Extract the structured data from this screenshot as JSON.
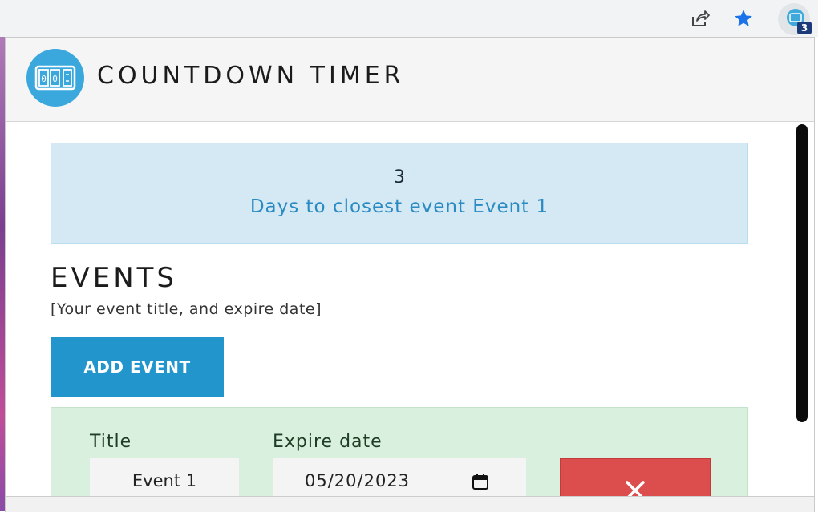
{
  "browser": {
    "share_icon": "share-icon",
    "bookmark_icon": "star-icon",
    "extension_icon": "countdown-extension-icon",
    "extension_badge": "3"
  },
  "app": {
    "title": "COUNTDOWN TIMER",
    "logo_icon": "countdown-timer-logo",
    "logo_digits": "00"
  },
  "notice": {
    "count": "3",
    "text": "Days to closest event Event 1"
  },
  "events": {
    "heading": "EVENTS",
    "subheading": "[Your event title, and expire date]",
    "add_button_label": "ADD EVENT",
    "items": [
      {
        "title_label": "Title",
        "title_value": "Event 1",
        "date_label": "Expire date",
        "date_value": "05/20/2023",
        "delete_icon": "close-icon"
      }
    ]
  },
  "colors": {
    "accent": "#2295cd",
    "notice_bg": "#d4e9f4",
    "event_bg": "#d9f0de",
    "delete": "#dc4d4d"
  }
}
